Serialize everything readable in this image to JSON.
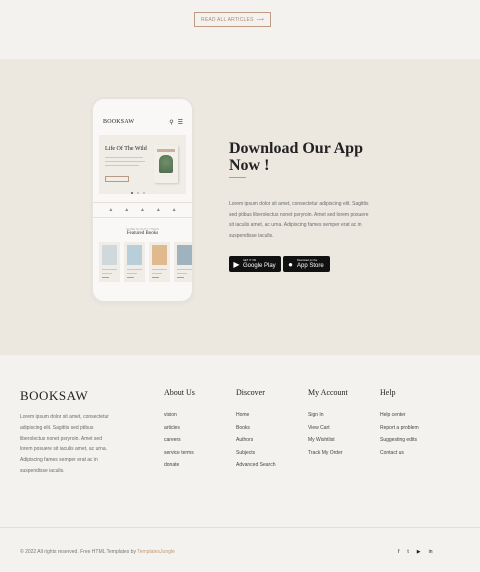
{
  "top": {
    "read_all_label": "READ ALL ARTICLES",
    "read_all_arrow": "⟶"
  },
  "phone": {
    "logo": "BOOKSAW",
    "hero_title": "Life Of The Wild",
    "book_cover_title": "Life Of The Wild",
    "featured_subtitle": "SOME QUALITY ITEMS",
    "featured_title": "Featured Books"
  },
  "app": {
    "title": "Download Our App Now !",
    "description": "Lorem ipsum dolor sit amet, consectetur adipiscing elit. Sagittis sed ptibus liberolectus nonet psryroin. Amet sed lorem posuere sit iaculis amet, ac urna. Adipiscing fames semper erat ac in suspendisse iaculis.",
    "google_small": "GET IT ON",
    "google_big": "Google Play",
    "apple_small": "Download on the",
    "apple_big": "App Store"
  },
  "footer": {
    "logo": "BOOKSAW",
    "about": "Lorem ipsum dolor sit amet, consectetur adipiscing elit. Sagittis sed ptibus liberolectus nonet psryroin. Amet sed lorem posuere sit iaculis amet, ac urna. Adipiscing fames semper erat ac in suspendisse iaculis.",
    "columns": [
      {
        "title": "About Us",
        "links": [
          "vision",
          "articles",
          "careers",
          "service terms",
          "donate"
        ]
      },
      {
        "title": "Discover",
        "links": [
          "Home",
          "Books",
          "Authors",
          "Subjects",
          "Advanced Search"
        ]
      },
      {
        "title": "My Account",
        "links": [
          "Sign In",
          "View Cart",
          "My Wishtlist",
          "Track My Order"
        ]
      },
      {
        "title": "Help",
        "links": [
          "Help center",
          "Report a problem",
          "Suggesting edits",
          "Contact us"
        ]
      }
    ],
    "copyright_text": "© 2022 All rights reserved. Free HTML Templates by ",
    "copyright_link": "TemplatesJungle",
    "socials": [
      "f",
      "t",
      "▶",
      "in"
    ]
  },
  "colors": {
    "accent": "#c49a73",
    "section_bg": "#ece8e0",
    "page_bg": "#f3f2ee"
  }
}
